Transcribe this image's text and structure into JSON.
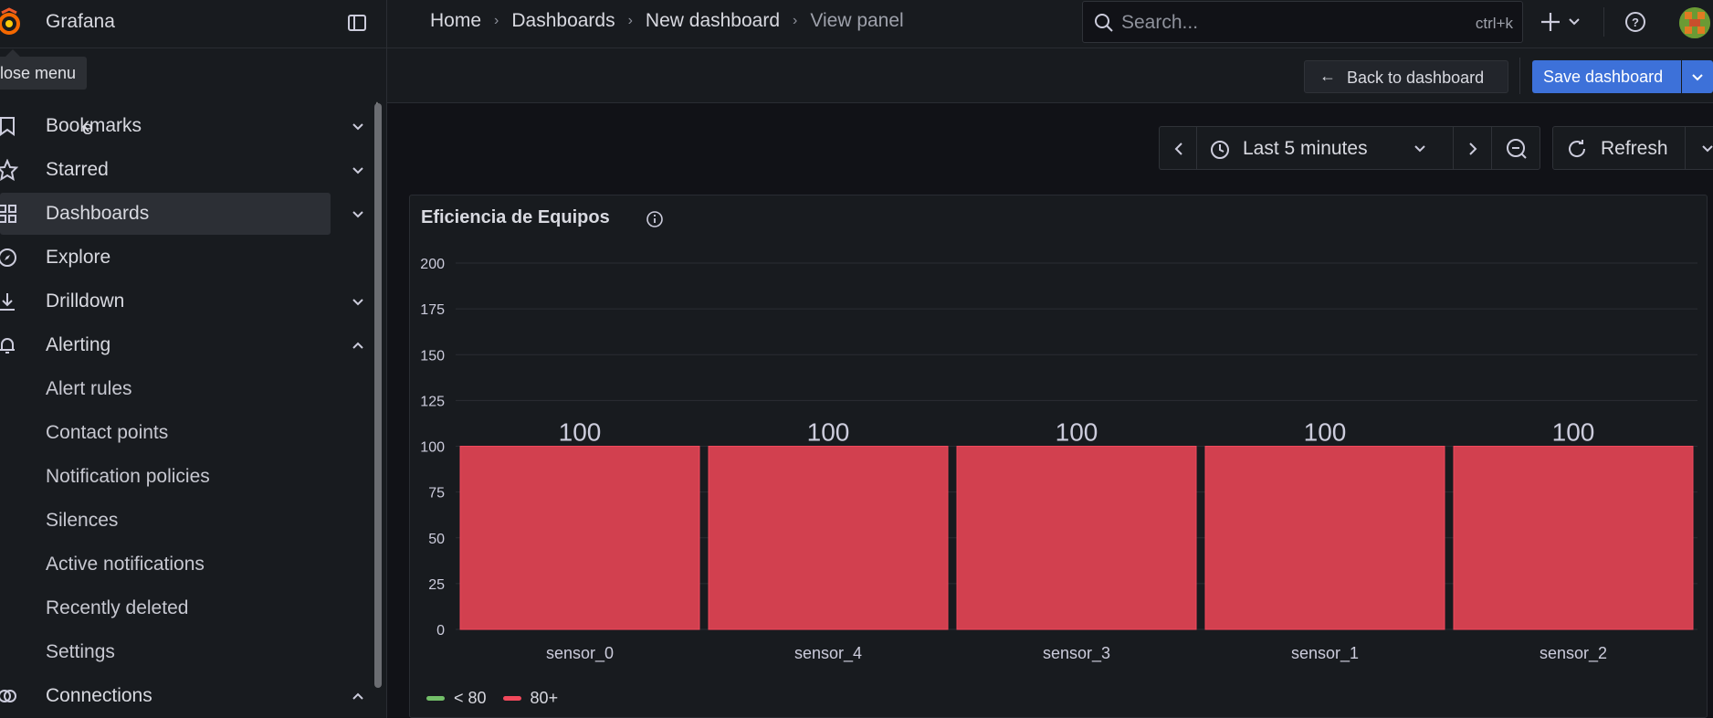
{
  "app": {
    "name": "Grafana"
  },
  "breadcrumbs": [
    "Home",
    "Dashboards",
    "New dashboard",
    "View panel"
  ],
  "search": {
    "placeholder": "Search...",
    "shortcut": "ctrl+k"
  },
  "tooltip": "lose menu",
  "nav_partial": "e",
  "nav": [
    {
      "label": "Bookmarks",
      "icon": "bookmark-icon",
      "chevron": "down"
    },
    {
      "label": "Starred",
      "icon": "star-icon",
      "chevron": "down"
    },
    {
      "label": "Dashboards",
      "icon": "apps-icon",
      "chevron": "down",
      "active": true
    },
    {
      "label": "Explore",
      "icon": "compass-icon"
    },
    {
      "label": "Drilldown",
      "icon": "drilldown-icon",
      "chevron": "down"
    },
    {
      "label": "Alerting",
      "icon": "bell-icon",
      "chevron": "up"
    }
  ],
  "alerting_sub": [
    "Alert rules",
    "Contact points",
    "Notification policies",
    "Silences",
    "Active notifications",
    "Recently deleted",
    "Settings"
  ],
  "connections": {
    "label": "Connections",
    "icon": "connections-icon",
    "chevron": "up"
  },
  "toolbar": {
    "back_label": "Back to dashboard",
    "save_label": "Save dashboard"
  },
  "timepicker": {
    "range": "Last 5 minutes",
    "refresh_label": "Refresh"
  },
  "panel": {
    "title": "Eficiencia de Equipos"
  },
  "colors": {
    "bar": "#d2404f",
    "accent": "#3d71d9",
    "green": "#73bf69",
    "red": "#f2495c"
  },
  "chart_data": {
    "type": "bar",
    "categories": [
      "sensor_0",
      "sensor_4",
      "sensor_3",
      "sensor_1",
      "sensor_2"
    ],
    "values": [
      100,
      100,
      100,
      100,
      100
    ],
    "ylim": [
      0,
      200
    ],
    "yticks": [
      0,
      25,
      50,
      75,
      100,
      125,
      150,
      175,
      200
    ],
    "grid": true,
    "legend": [
      {
        "name": "< 80",
        "color": "#73bf69"
      },
      {
        "name": "80+",
        "color": "#f2495c"
      }
    ]
  }
}
